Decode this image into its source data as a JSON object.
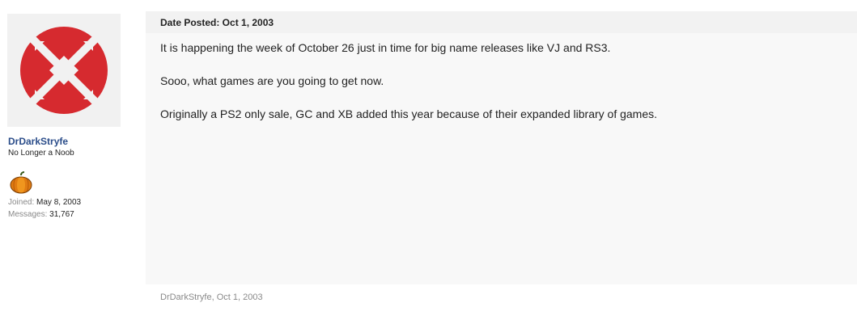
{
  "user": {
    "avatar_name": "ign-logo",
    "username": "DrDarkStryfe",
    "title": "No Longer a Noob",
    "trophy_icon": "pumpkin-icon",
    "joined_label": "Joined:",
    "joined_value": "May 8, 2003",
    "messages_label": "Messages:",
    "messages_value": "31,767"
  },
  "post": {
    "date_label": "Date Posted: Oct 1, 2003",
    "paragraphs": [
      "It is happening the week of October 26 just in time for big name releases like VJ and RS3.",
      "Sooo, what games are you going to get now.",
      "Originally a PS2 only sale, GC and XB added this year because of their expanded library of games."
    ],
    "footer_author": "DrDarkStryfe",
    "footer_date": "Oct 1, 2003"
  },
  "colors": {
    "logo_red": "#d62a2f",
    "username_blue": "#2b4d8a",
    "message_bg": "#f8f8f8",
    "header_bg": "#f2f2f2",
    "muted_text": "#8a8a8a"
  }
}
